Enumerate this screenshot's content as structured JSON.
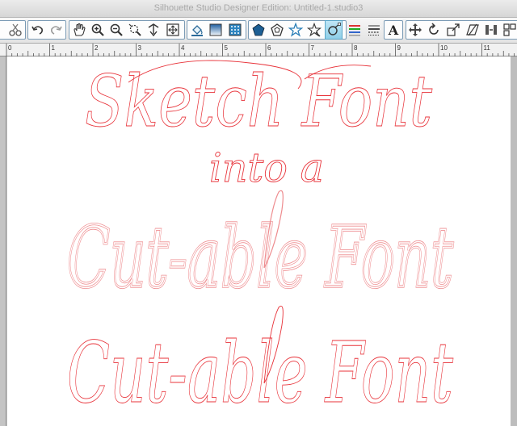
{
  "window": {
    "title": "Silhouette Studio Designer Edition: Untitled-1.studio3"
  },
  "toolbar": {
    "tools": [
      {
        "icon": "scissors-icon",
        "name": "cut-button"
      },
      {
        "icon": "undo-icon",
        "name": "undo-button"
      },
      {
        "icon": "redo-icon",
        "name": "redo-button"
      },
      {
        "icon": "hand-pan-icon",
        "name": "pan-tool-button"
      },
      {
        "icon": "zoom-in-icon",
        "name": "zoom-in-button"
      },
      {
        "icon": "zoom-out-icon",
        "name": "zoom-out-button"
      },
      {
        "icon": "zoom-selection-icon",
        "name": "zoom-selection-button"
      },
      {
        "icon": "move-down-icon",
        "name": "drag-zoom-button"
      },
      {
        "icon": "fit-to-page-icon",
        "name": "fit-to-page-button"
      },
      {
        "icon": "fill-bucket-icon",
        "name": "fill-color-button"
      },
      {
        "icon": "gradient-icon",
        "name": "fill-gradient-button"
      },
      {
        "icon": "pattern-icon",
        "name": "fill-pattern-button"
      },
      {
        "icon": "pentagon-icon",
        "name": "shape-pentagon-button"
      },
      {
        "icon": "pentagon-outline-icon",
        "name": "shape-outline-button"
      },
      {
        "icon": "star-icon",
        "name": "shape-star-button"
      },
      {
        "icon": "star-outline-icon",
        "name": "shape-star-outline-button"
      },
      {
        "icon": "point-edit-icon",
        "name": "point-edit-button",
        "active": true
      },
      {
        "icon": "line-color-icon",
        "name": "line-color-button"
      },
      {
        "icon": "line-style-icon",
        "name": "line-style-button"
      },
      {
        "icon": "text-style-icon",
        "name": "text-style-button",
        "glyph": "A"
      },
      {
        "icon": "transform-icon",
        "name": "transform-button"
      },
      {
        "icon": "rotate-icon",
        "name": "rotate-button"
      },
      {
        "icon": "scale-icon",
        "name": "scale-button"
      },
      {
        "icon": "shear-icon",
        "name": "shear-button"
      },
      {
        "icon": "align-icon",
        "name": "align-button"
      },
      {
        "icon": "replicate-icon",
        "name": "replicate-button"
      }
    ]
  },
  "ruler": {
    "labels": [
      "0",
      "1",
      "2",
      "3",
      "4",
      "5",
      "6",
      "7",
      "8",
      "9",
      "10",
      "11"
    ]
  },
  "canvas": {
    "line1": "Sketch Font",
    "line2": "into a",
    "line3": "Cut-able Font",
    "line4": "Cut-able Font",
    "stroke_color": "#e8333a",
    "stroke_color_soft": "#ee8c8f"
  }
}
